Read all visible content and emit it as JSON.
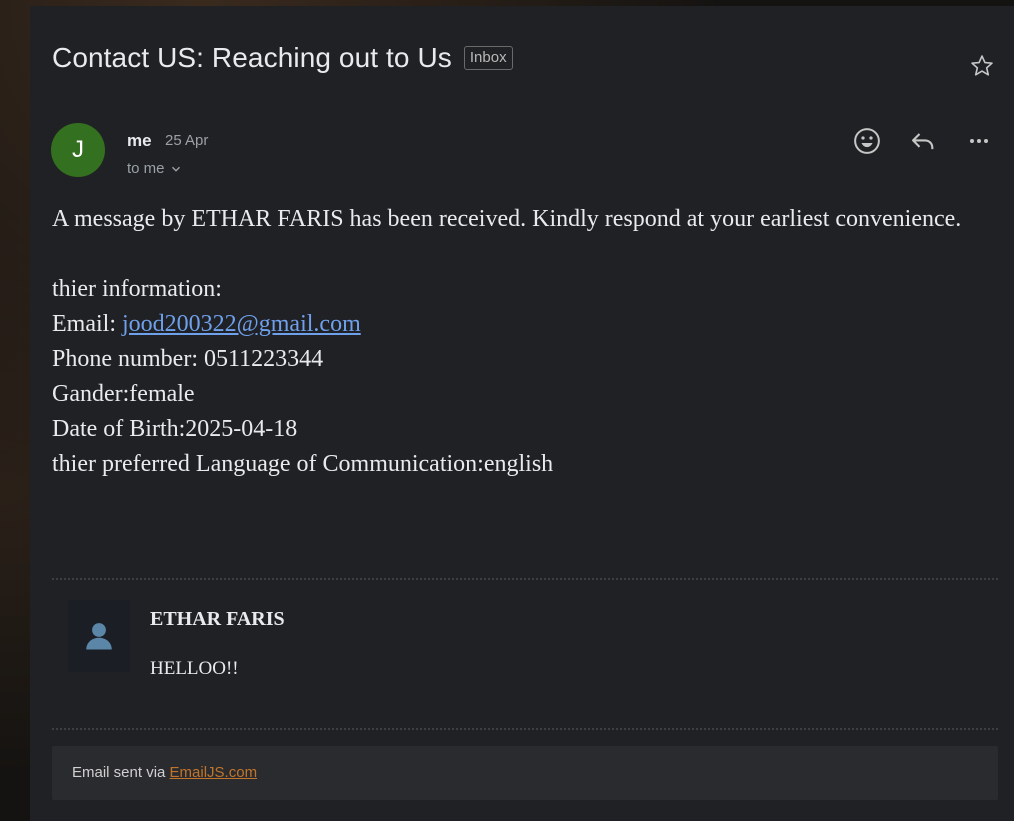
{
  "email": {
    "subject": "Contact US: Reaching out to Us",
    "label": "Inbox",
    "sender": {
      "avatar_initial": "J",
      "name": "me",
      "date": "25 Apr",
      "recipient": "to me"
    },
    "body": {
      "intro": "A message by ETHAR FARIS has been received. Kindly respond at your earliest convenience.",
      "info_heading": "thier information:",
      "email_label": "Email: ",
      "email_value": "jood200322@gmail.com",
      "phone": "Phone number: 0511223344",
      "gender": "Gander:female",
      "dob": "Date of Birth:2025-04-18",
      "language": "thier preferred Language of Communication:english"
    },
    "message": {
      "author": "ETHAR FARIS",
      "text": "HELLOO!!"
    },
    "footer": {
      "prefix": "Email sent via ",
      "link": "EmailJS.com"
    }
  },
  "icons": {
    "star": "star-icon",
    "emoji": "emoji-icon",
    "reply": "reply-icon",
    "more": "more-icon",
    "chevron": "chevron-down-icon",
    "person": "person-icon"
  },
  "colors": {
    "panel": "#202124",
    "avatar": "#33701f",
    "link": "#6ea0ec",
    "footer_link": "#c2752a"
  }
}
